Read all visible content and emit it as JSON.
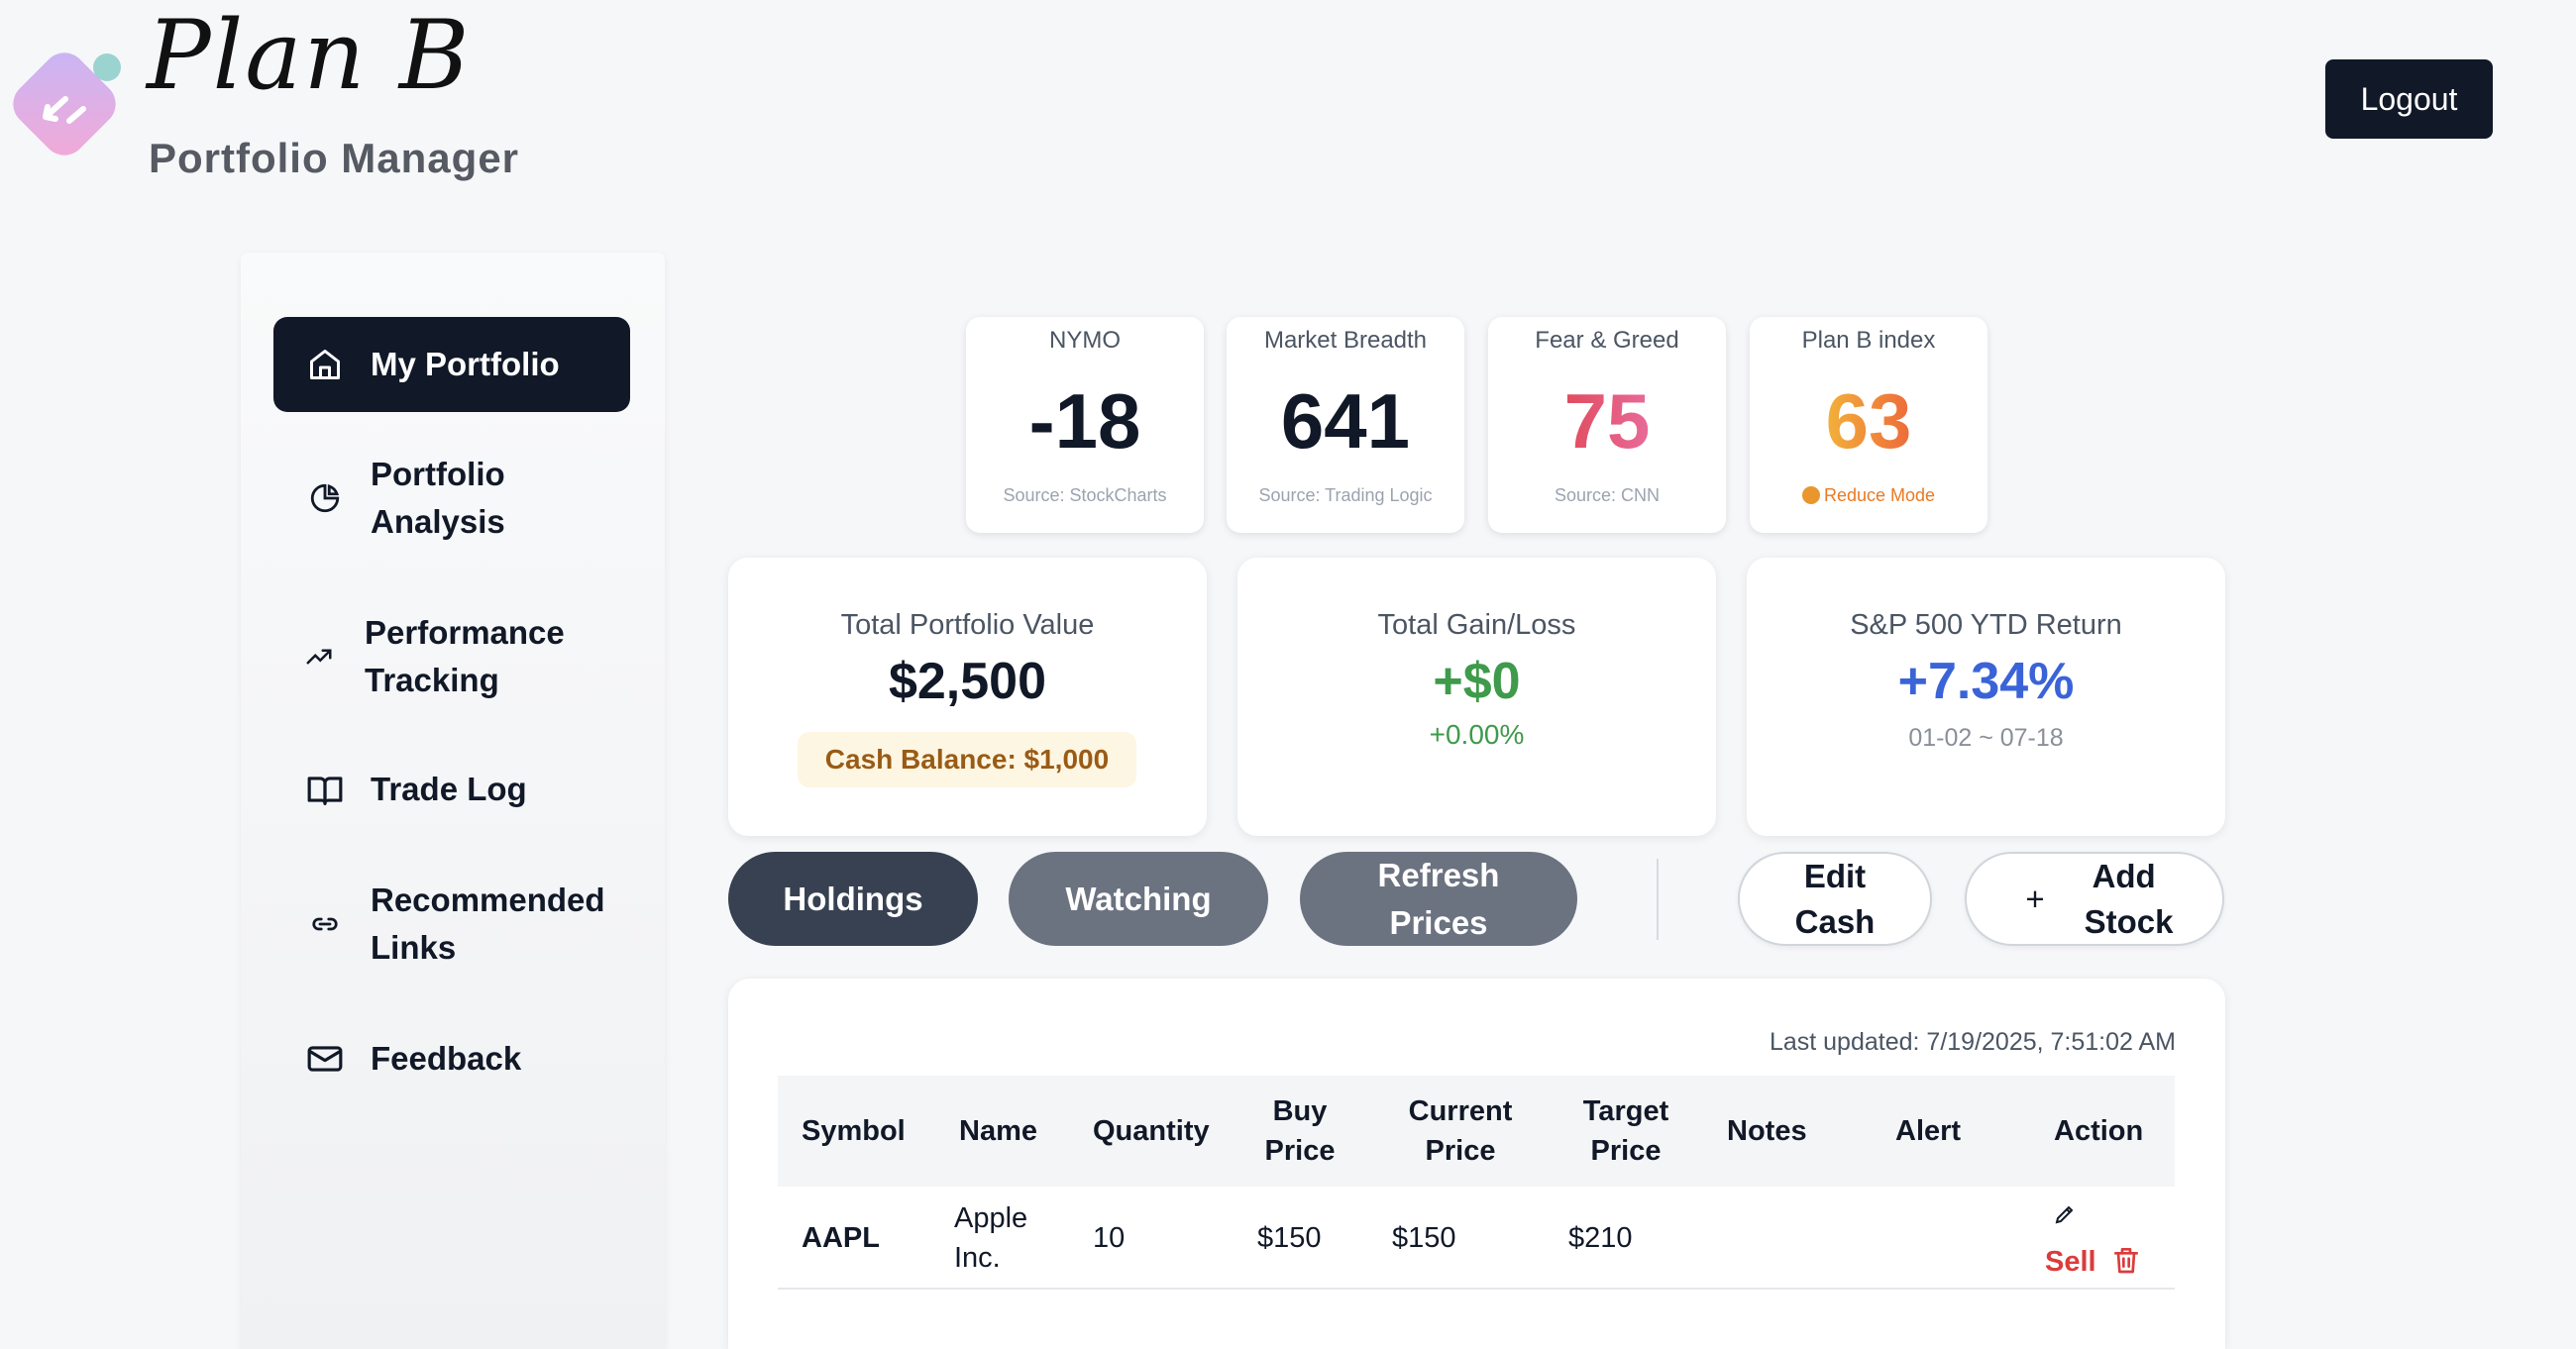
{
  "header": {
    "brand_title": "Plan B",
    "brand_subtitle": "Portfolio Manager",
    "logout_label": "Logout"
  },
  "sidebar": {
    "items": [
      {
        "label": "My Portfolio",
        "icon": "home-icon",
        "active": true
      },
      {
        "label": "Portfolio Analysis",
        "icon": "pie-chart-icon"
      },
      {
        "label": "Performance Tracking",
        "icon": "trending-up-icon"
      },
      {
        "label": "Trade Log",
        "icon": "book-open-icon"
      },
      {
        "label": "Recommended Links",
        "icon": "link-icon"
      },
      {
        "label": "Feedback",
        "icon": "mail-icon"
      }
    ]
  },
  "indicators": [
    {
      "label": "NYMO",
      "value": "-18",
      "source": "Source: StockCharts"
    },
    {
      "label": "Market Breadth",
      "value": "641",
      "source": "Source: Trading Logic"
    },
    {
      "label": "Fear & Greed",
      "value": "75",
      "source": "Source: CNN"
    },
    {
      "label": "Plan B index",
      "value": "63",
      "source": "Reduce Mode"
    }
  ],
  "summary": {
    "total_value": {
      "label": "Total Portfolio Value",
      "value": "$2,500",
      "cash": "Cash Balance: $1,000"
    },
    "gain_loss": {
      "label": "Total Gain/Loss",
      "value": "+$0",
      "pct": "+0.00%"
    },
    "sp500": {
      "label": "S&P 500 YTD Return",
      "value": "+7.34%",
      "range": "01-02 ~ 07-18"
    }
  },
  "actions": {
    "holdings": "Holdings",
    "watching": "Watching",
    "refresh": "Refresh Prices",
    "edit_cash": "Edit Cash",
    "add_stock_plus": "+",
    "add_stock": "Add Stock"
  },
  "table": {
    "last_updated": "Last updated: 7/19/2025, 7:51:02 AM",
    "columns": [
      "Symbol",
      "Name",
      "Quantity",
      "Buy Price",
      "Current Price",
      "Target Price",
      "Notes",
      "Alert",
      "Action"
    ],
    "rows": [
      {
        "symbol": "AAPL",
        "name": "Apple Inc.",
        "quantity": "10",
        "buy_price": "$150",
        "current_price": "$150",
        "target_price": "$210",
        "notes": "",
        "alert": "",
        "sell_label": "Sell"
      }
    ]
  },
  "colors": {
    "primary_dark": "#111827",
    "gain_green": "#3f9a4b",
    "sp500_blue": "#3b63d8",
    "sell_red": "#dc3b3b",
    "reduce_orange": "#ea7a23"
  }
}
